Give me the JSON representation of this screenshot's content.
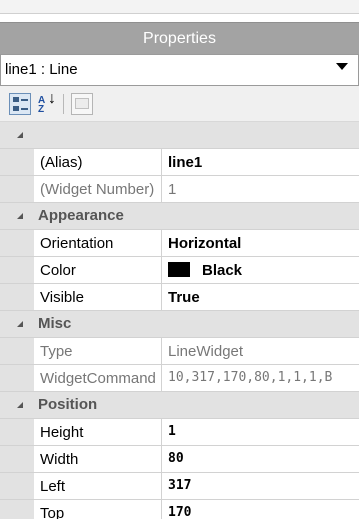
{
  "panel": {
    "title": "Properties",
    "selector": "line1 : Line"
  },
  "categories": {
    "general": "",
    "appearance": "Appearance",
    "misc": "Misc",
    "position": "Position"
  },
  "props": {
    "alias": {
      "name": "(Alias)",
      "value": "line1"
    },
    "widget_number": {
      "name": "(Widget Number)",
      "value": "1"
    },
    "orientation": {
      "name": "Orientation",
      "value": "Horizontal"
    },
    "color": {
      "name": "Color",
      "value": "Black",
      "swatch": "#000000"
    },
    "visible": {
      "name": "Visible",
      "value": "True"
    },
    "type": {
      "name": "Type",
      "value": "LineWidget"
    },
    "widget_command": {
      "name": "WidgetCommand",
      "value": "10,317,170,80,1,1,1,B"
    },
    "height": {
      "name": "Height",
      "value": "1"
    },
    "width": {
      "name": "Width",
      "value": "80"
    },
    "left": {
      "name": "Left",
      "value": "317"
    },
    "top": {
      "name": "Top",
      "value": "170"
    }
  },
  "icons": [
    "categorized-icon",
    "alphabetical-sort-icon",
    "property-pages-icon",
    "dropdown-arrow-icon",
    "collapse-triangle-icon"
  ],
  "colors": {
    "title_bar": "#a3a3a3",
    "category_bg": "#e2e2e2",
    "category_text": "#555555"
  }
}
